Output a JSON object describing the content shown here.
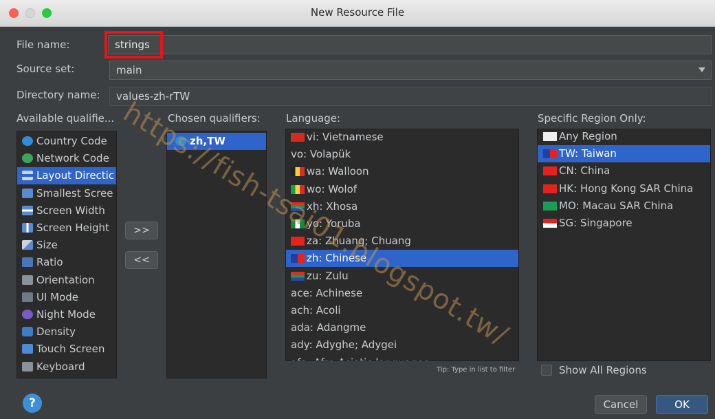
{
  "window": {
    "title": "New Resource File"
  },
  "form": {
    "file_name_label": "File name:",
    "file_name_value": "strings",
    "source_set_label": "Source set:",
    "source_set_value": "main",
    "directory_label": "Directory name:",
    "directory_value": "values-zh-rTW"
  },
  "available": {
    "header": "Available qualifie...",
    "items": [
      {
        "label": "Country Code",
        "icon": "globe-icon"
      },
      {
        "label": "Network Code",
        "icon": "network-icon"
      },
      {
        "label": "Layout Directic",
        "icon": "layout-direction-icon"
      },
      {
        "label": "Smallest Scree",
        "icon": "smallest-screen-icon"
      },
      {
        "label": "Screen Width",
        "icon": "screen-width-icon"
      },
      {
        "label": "Screen Height",
        "icon": "screen-height-icon"
      },
      {
        "label": "Size",
        "icon": "size-icon"
      },
      {
        "label": "Ratio",
        "icon": "ratio-icon"
      },
      {
        "label": "Orientation",
        "icon": "orientation-icon"
      },
      {
        "label": "UI Mode",
        "icon": "ui-mode-icon"
      },
      {
        "label": "Night Mode",
        "icon": "night-mode-icon"
      },
      {
        "label": "Density",
        "icon": "density-icon"
      },
      {
        "label": "Touch Screen",
        "icon": "touch-screen-icon"
      },
      {
        "label": "Keyboard",
        "icon": "keyboard-icon"
      }
    ],
    "selected_index": 2
  },
  "buttons": {
    "add": ">>",
    "remove": "<<",
    "cancel": "Cancel",
    "ok": "OK"
  },
  "chosen": {
    "header": "Chosen qualifiers:",
    "items": [
      {
        "label": "zh,TW",
        "icon": "globe-icon"
      }
    ]
  },
  "language": {
    "header": "Language:",
    "items": [
      {
        "label": "vi: Vietnamese",
        "flag": "vietnam-flag-icon"
      },
      {
        "label": "vo: Volapük",
        "flag": ""
      },
      {
        "label": "wa: Walloon",
        "flag": "belgium-flag-icon"
      },
      {
        "label": "wo: Wolof",
        "flag": "senegal-flag-icon"
      },
      {
        "label": "xh: Xhosa",
        "flag": "south-africa-flag-icon"
      },
      {
        "label": "yo: Yoruba",
        "flag": "nigeria-flag-icon"
      },
      {
        "label": "za: Zhuang; Chuang",
        "flag": "china-flag-icon"
      },
      {
        "label": "zh: Chinese",
        "flag": "taiwan-flag-icon"
      },
      {
        "label": "zu: Zulu",
        "flag": "south-africa-flag-icon"
      },
      {
        "label": "ace: Achinese",
        "flag": ""
      },
      {
        "label": "ach: Acoli",
        "flag": ""
      },
      {
        "label": "ada: Adangme",
        "flag": ""
      },
      {
        "label": "ady: Adyghe; Adygei",
        "flag": ""
      },
      {
        "label": "afa: Afro-Asiatic languages",
        "flag": ""
      }
    ],
    "selected_index": 7,
    "tip": "Tip: Type in list to filter"
  },
  "region": {
    "header": "Specific Region Only:",
    "items": [
      {
        "label": "Any Region",
        "flag": "blank-flag-icon"
      },
      {
        "label": "TW: Taiwan",
        "flag": "taiwan-flag-icon"
      },
      {
        "label": "CN: China",
        "flag": "china-flag-icon"
      },
      {
        "label": "HK: Hong Kong SAR China",
        "flag": "hong-kong-flag-icon"
      },
      {
        "label": "MO: Macau SAR China",
        "flag": "macau-flag-icon"
      },
      {
        "label": "SG: Singapore",
        "flag": "singapore-flag-icon"
      }
    ],
    "selected_index": 1,
    "show_all_label": "Show All Regions"
  },
  "watermark": "https://fish-tsai01.blogspot.tw/",
  "colors": {
    "selection": "#2f65ca",
    "highlight": "#e8141a",
    "help": "#3f8fd8"
  }
}
